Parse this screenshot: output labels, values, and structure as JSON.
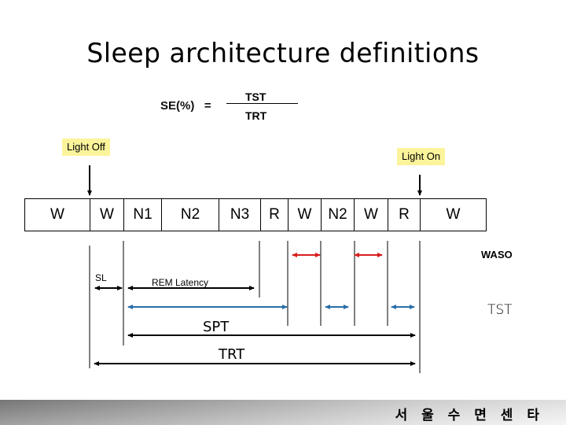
{
  "title": "Sleep architecture definitions",
  "formula": {
    "lhs": "SE(%)   =",
    "numerator": "TST",
    "denominator": "TRT"
  },
  "callouts": {
    "light_off": "Light Off",
    "light_on": "Light On",
    "callout_color": "#fbf49b"
  },
  "hypnogram": {
    "stages": [
      "W",
      "W",
      "N1",
      "N2",
      "N3",
      "R",
      "W",
      "N2",
      "W",
      "R",
      "W"
    ]
  },
  "labels": {
    "waso": "WASO",
    "sl": "SL",
    "rem_latency": "REM Latency",
    "tst": "TST",
    "spt": "SPT",
    "trt": "TRT"
  },
  "colors": {
    "waso_arrow": "#d81e1e",
    "tst_arrow": "#2a6fa8",
    "black_arrow": "#000000"
  },
  "footer": {
    "org_name": "서 울 수 면 센 타"
  }
}
